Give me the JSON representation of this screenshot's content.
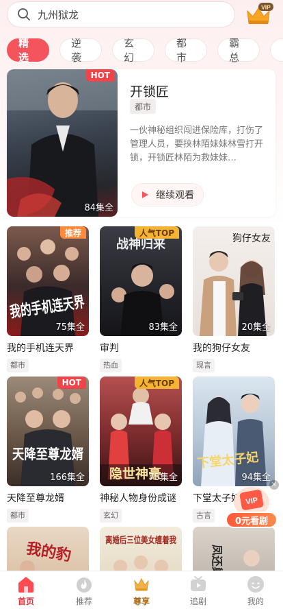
{
  "search": {
    "query": "九州狱龙"
  },
  "vip_badge": "VIP",
  "tabs": [
    "精选",
    "逆袭",
    "玄幻",
    "都市",
    "霸总"
  ],
  "hero": {
    "title": "开锁匠",
    "tag": "都市",
    "description": "一伙神秘组织闯进保险库，打伤了管理人员，要挟林陌妹妹林雪打开锁，开锁匠林陌为救妹妹…",
    "badge": "HOT",
    "episodes": "84集全",
    "button": "继续观看"
  },
  "dramas": [
    {
      "title": "我的手机连天界",
      "tag": "都市",
      "badge": "推荐",
      "episodes": "75集全",
      "poster_text": "我的手机连天界"
    },
    {
      "title": "审判",
      "tag": "热血",
      "badge": "人气TOP",
      "episodes": "83集全",
      "poster_text": "战神归来"
    },
    {
      "title": "我的狗仔女友",
      "tag": "现言",
      "badge": "",
      "episodes": "20集全",
      "poster_text": "狗仔女友"
    },
    {
      "title": "天降至尊龙婿",
      "tag": "都市",
      "badge": "HOT",
      "episodes": "166集全",
      "poster_text": "天降至尊龙婿"
    },
    {
      "title": "神秘人物身份成谜",
      "tag": "玄幻",
      "badge": "人气TOP",
      "episodes": "75集全",
      "poster_text": "隐世神豪"
    },
    {
      "title": "下堂太子妃",
      "tag": "古言",
      "badge": "",
      "episodes": "94集全",
      "poster_text": "下堂太子妃"
    },
    {
      "title": "",
      "tag": "",
      "badge": "",
      "episodes": "",
      "poster_text": "我的豹"
    },
    {
      "title": "",
      "tag": "",
      "badge": "",
      "episodes": "",
      "poster_text": "离婚后三位美女缠着我"
    },
    {
      "title": "",
      "tag": "",
      "badge": "",
      "episodes": "",
      "poster_text": "凤还巢"
    }
  ],
  "promo": {
    "label": "0元看剧",
    "vip": "VIP"
  },
  "nav": [
    "首页",
    "推荐",
    "尊享",
    "追剧",
    "我的"
  ],
  "colors": {
    "accent": "#f4545b",
    "badge_hot": "#f0434a",
    "badge_top": "#f3b431"
  }
}
